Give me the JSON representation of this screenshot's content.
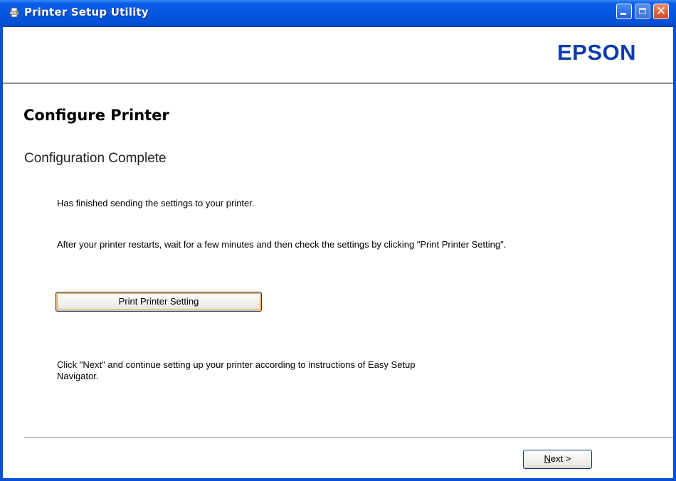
{
  "window": {
    "title": "Printer Setup Utility",
    "icon": "printer-utility-icon",
    "controls": {
      "minimize": "minimize-icon",
      "maximize": "maximize-icon",
      "close_glyph": "✕"
    }
  },
  "header": {
    "brand": "EPSON"
  },
  "main": {
    "title": "Configure Printer",
    "subtitle": "Configuration Complete",
    "message_finished": "Has finished sending the settings to your printer.",
    "message_restart": "After your printer restarts, wait for a few minutes and then check the settings by clicking \"Print Printer Setting\".",
    "print_button_label": "Print Printer Setting",
    "message_next": "Click \"Next\" and continue setting up your printer according to instructions of Easy Setup Navigator."
  },
  "footer": {
    "next_button_label": "Next >",
    "next_mnemonic": "N",
    "next_rest": "ext >"
  },
  "colors": {
    "titlebar": "#0556e0",
    "brand": "#0b3cac",
    "window_frame": "#0a4fd8"
  }
}
